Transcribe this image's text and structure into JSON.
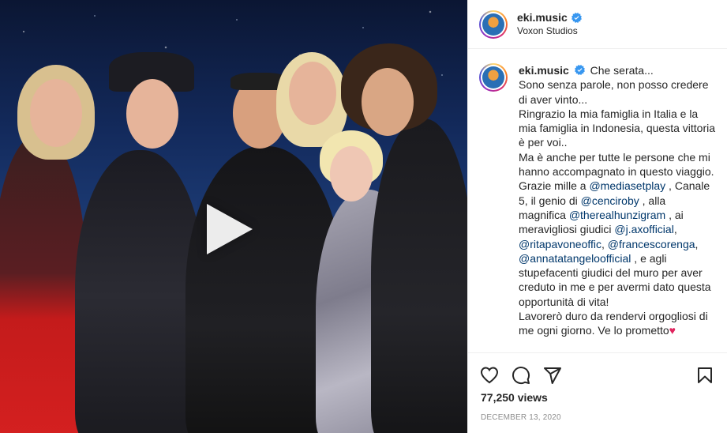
{
  "post": {
    "username": "eki.music",
    "location": "Voxon Studios",
    "caption_intro": "Che serata...",
    "caption_segments": [
      {
        "text": "Sono senza parole, non posso credere di aver vinto...",
        "type": "text"
      },
      {
        "text": "Ringrazio la mia famiglia in Italia e la mia famiglia in Indonesia, questa vittoria è per voi..",
        "type": "text"
      },
      {
        "text": "Ma è anche per tutte le persone che mi hanno accompagnato in questo viaggio.",
        "type": "text"
      }
    ],
    "thanks_prefix": "Grazie mille a ",
    "mentions": {
      "mediasetplay": "@mediasetplay",
      "cenciroby": "@cenciroby",
      "therealhunzigram": "@therealhunzigram",
      "jax": "@j.axofficial",
      "ritapavone": "@ritapavoneoffic",
      "francescorenga": "@francescorenga",
      "annatatangelo": "@annatatangeloofficial"
    },
    "thanks_mid1": " , Canale 5, il genio di ",
    "thanks_mid2": " , alla magnifica ",
    "thanks_mid3": " , ai meravigliosi giudici ",
    "thanks_sep1": ",",
    "thanks_sep2": ",",
    "thanks_mid4": " , e agli stupefacenti giudici del muro per aver creduto in me e per avermi dato questa opportunità di vita!",
    "closing": "Lavorerò duro da rendervi orgogliosi di me ogni giorno. Ve lo prometto",
    "closing_emoji": "♥",
    "views": "77,250 views",
    "date": "December 13, 2020"
  },
  "icons": {
    "like": "heart-icon",
    "comment": "comment-icon",
    "share": "share-icon",
    "save": "bookmark-icon",
    "verified": "verified-badge-icon",
    "play": "play-icon"
  },
  "colors": {
    "verified": "#3897f0",
    "mention": "#00376b",
    "muted": "#8e8e8e",
    "border": "#efefef"
  }
}
